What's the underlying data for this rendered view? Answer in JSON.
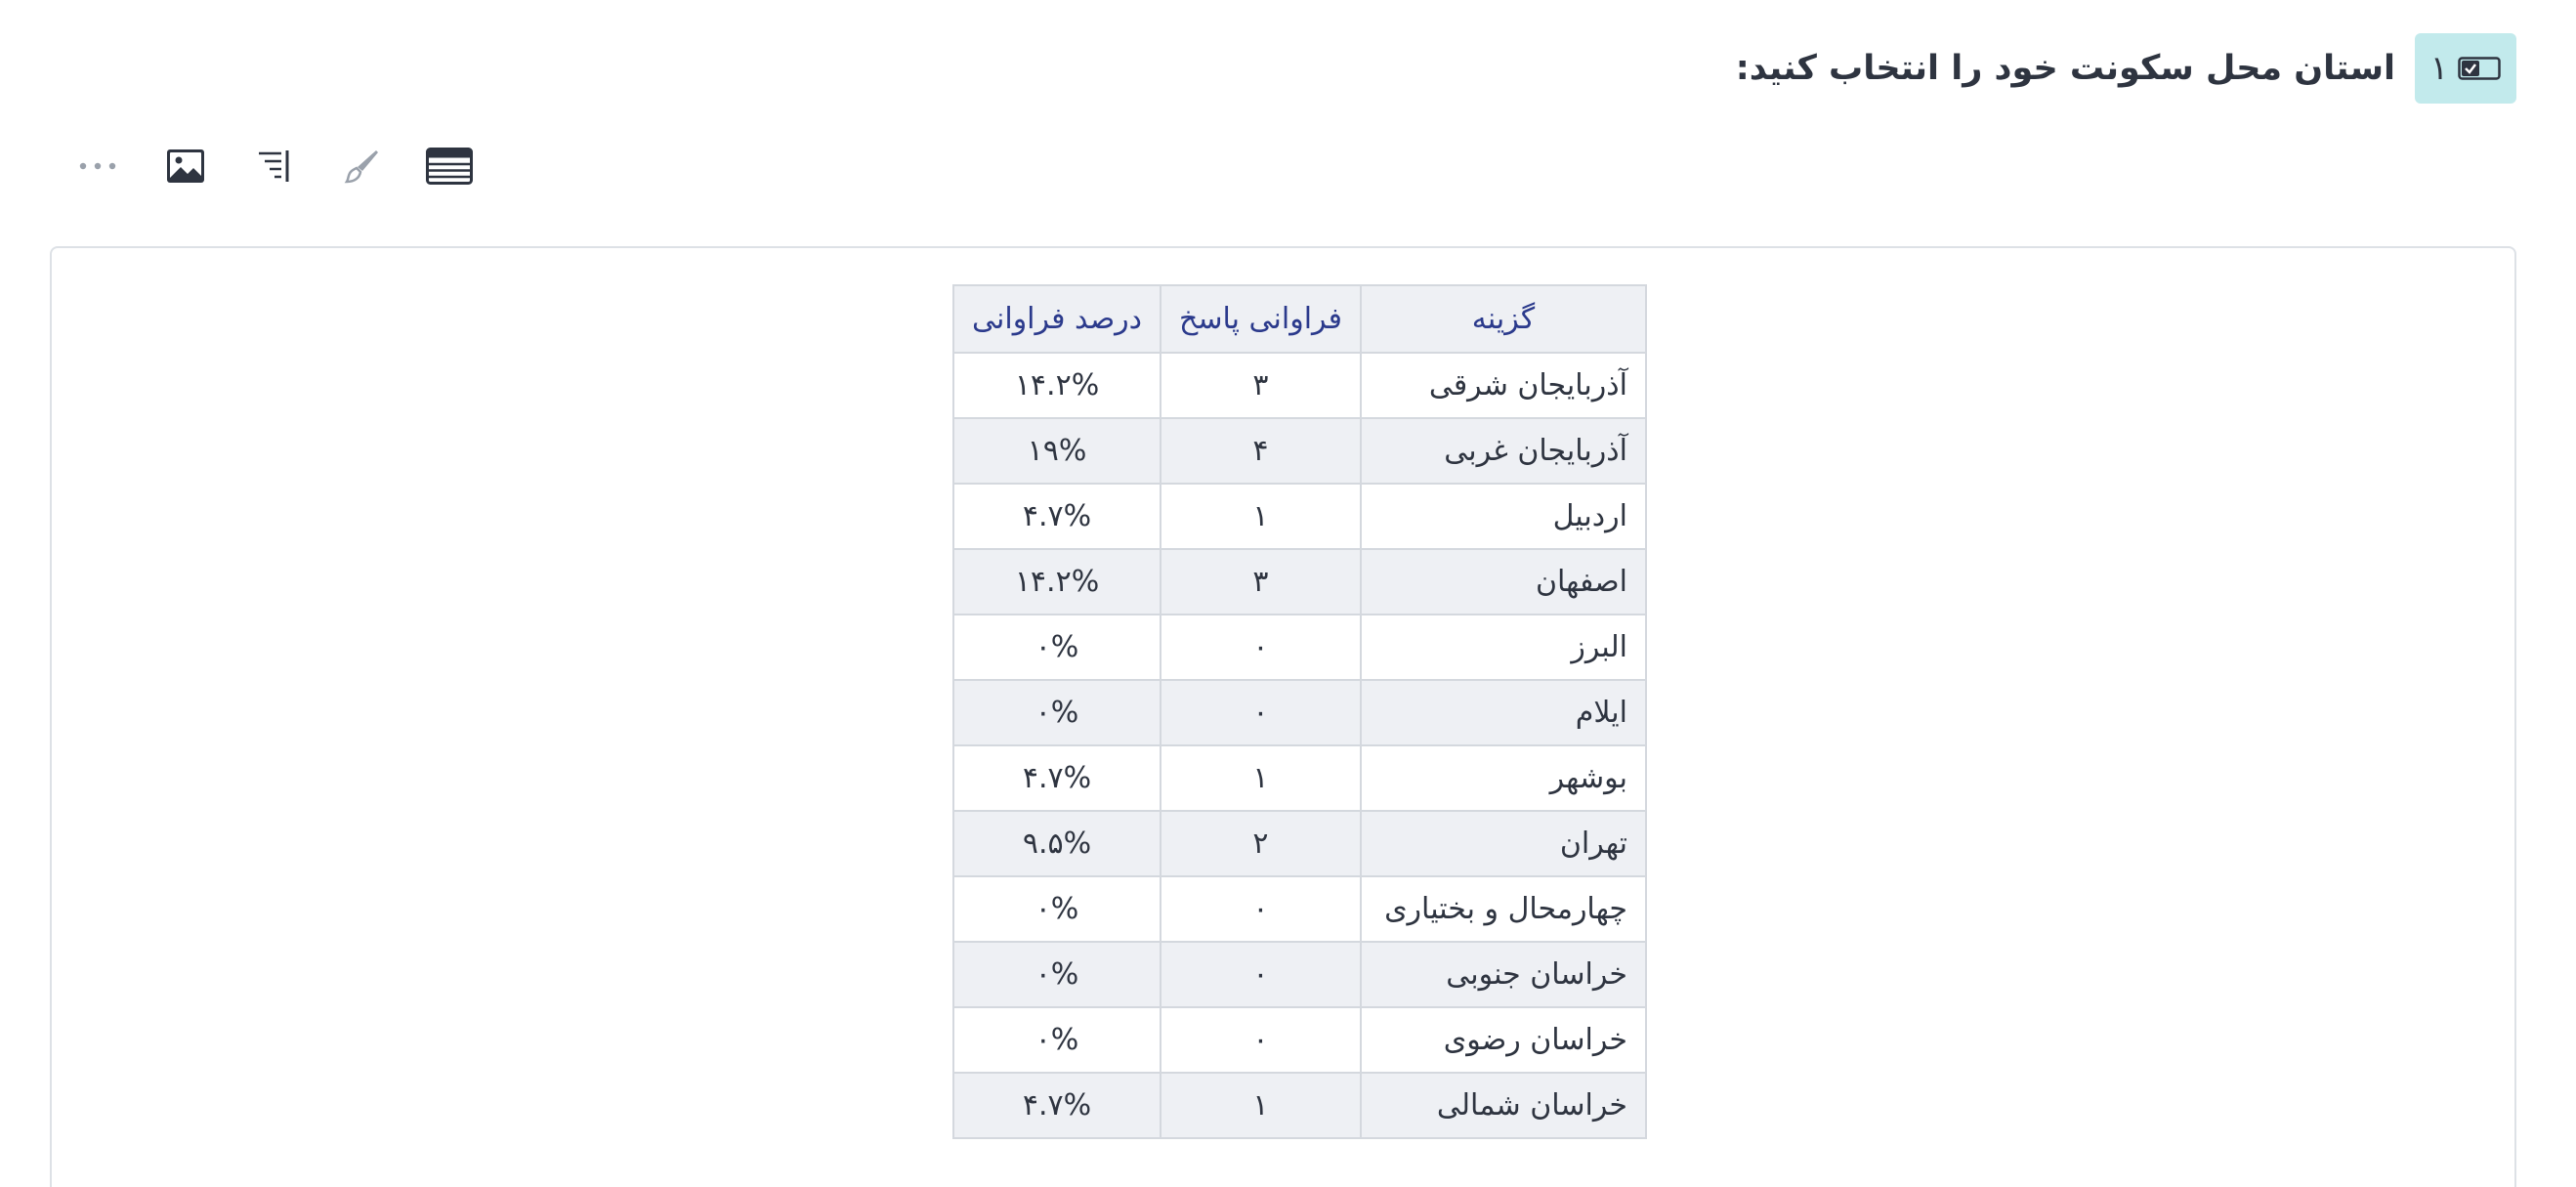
{
  "question": {
    "number": "۱",
    "title": "استان محل سکونت خود را انتخاب کنید:",
    "type_icon": "checkbox-dropdown-icon"
  },
  "toolbar": {
    "items": [
      {
        "icon": "more-icon"
      },
      {
        "icon": "image-icon"
      },
      {
        "icon": "sort-icon"
      },
      {
        "icon": "brush-icon"
      },
      {
        "icon": "table-view-icon"
      }
    ]
  },
  "table": {
    "headers": {
      "option": "گزینه",
      "count": "فراوانی پاسخ",
      "percent": "درصد فراوانی"
    },
    "rows": [
      {
        "option": "آذربایجان شرقی",
        "count": "۳",
        "percent": "۱۴.۲%"
      },
      {
        "option": "آذربایجان غربی",
        "count": "۴",
        "percent": "۱۹%"
      },
      {
        "option": "اردبیل",
        "count": "۱",
        "percent": "۴.۷%"
      },
      {
        "option": "اصفهان",
        "count": "۳",
        "percent": "۱۴.۲%"
      },
      {
        "option": "البرز",
        "count": "۰",
        "percent": "۰%"
      },
      {
        "option": "ایلام",
        "count": "۰",
        "percent": "۰%"
      },
      {
        "option": "بوشهر",
        "count": "۱",
        "percent": "۴.۷%"
      },
      {
        "option": "تهران",
        "count": "۲",
        "percent": "۹.۵%"
      },
      {
        "option": "چهارمحال و بختیاری",
        "count": "۰",
        "percent": "۰%"
      },
      {
        "option": "خراسان جنوبی",
        "count": "۰",
        "percent": "۰%"
      },
      {
        "option": "خراسان رضوی",
        "count": "۰",
        "percent": "۰%"
      },
      {
        "option": "خراسان شمالی",
        "count": "۱",
        "percent": "۴.۷%"
      }
    ]
  },
  "colors": {
    "badge_bg": "#c2eaec",
    "header_text": "#2b3a8c",
    "row_alt": "#eef0f4",
    "border": "#d4d8de"
  }
}
